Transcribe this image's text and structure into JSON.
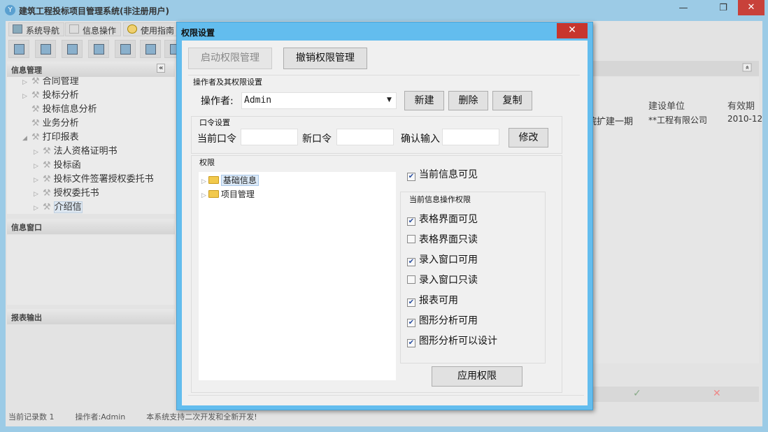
{
  "app": {
    "title": "建筑工程投标项目管理系统(非注册用户)",
    "logo": "Y"
  },
  "window_controls": {
    "minimize": "—",
    "restore": "❐",
    "close": "✕"
  },
  "tabs": [
    {
      "label": "系统导航"
    },
    {
      "label": "信息操作"
    },
    {
      "label": "使用指南"
    }
  ],
  "panels": {
    "info_mgmt": "信息管理",
    "collapse": "«",
    "info_window": "信息窗口",
    "report_output": "报表输出"
  },
  "nav_tree": [
    {
      "label": "合同管理",
      "level": 0,
      "arrow": "▷"
    },
    {
      "label": "投标分析",
      "level": 0,
      "arrow": "▷"
    },
    {
      "label": "投标信息分析",
      "level": 0,
      "arrow": ""
    },
    {
      "label": "业务分析",
      "level": 0,
      "arrow": ""
    },
    {
      "label": "打印报表",
      "level": 0,
      "arrow": "◢"
    },
    {
      "label": "法人资格证明书",
      "level": 1,
      "arrow": "▷"
    },
    {
      "label": "投标函",
      "level": 1,
      "arrow": "▷"
    },
    {
      "label": "投标文件签署授权委托书",
      "level": 1,
      "arrow": "▷"
    },
    {
      "label": "授权委托书",
      "level": 1,
      "arrow": "▷"
    },
    {
      "label": "介绍信",
      "level": 1,
      "arrow": "▷",
      "selected": true
    }
  ],
  "grid": {
    "expand": "«",
    "columns": [
      "建设单位",
      "有效期"
    ],
    "row": [
      "院扩建一期",
      "**工程有限公司",
      "2010-12"
    ],
    "ok": "✓",
    "cancel": "✕"
  },
  "status": {
    "records": "当前记录数 1",
    "operator": "操作者:Admin",
    "note": "本系统支持二次开发和全新开发!"
  },
  "dialog": {
    "title": "权限设置",
    "close": "✕",
    "start_btn": "启动权限管理",
    "revoke_btn": "撤销权限管理",
    "operator_section": "操作者及其权限设置",
    "operator_label": "操作者:",
    "operator_value": "Admin",
    "new_btn": "新建",
    "delete_btn": "删除",
    "copy_btn": "复制",
    "pwd_section": "口令设置",
    "cur_pwd": "当前口令",
    "new_pwd": "新口令",
    "confirm_pwd": "确认输入",
    "modify_btn": "修改",
    "perm_section": "权限",
    "perm_tree": [
      {
        "label": "基础信息",
        "selected": true
      },
      {
        "label": "项目管理"
      }
    ],
    "visible": {
      "label": "当前信息可见",
      "checked": true
    },
    "ops_section": "当前信息操作权限",
    "ops": [
      {
        "label": "表格界面可见",
        "checked": true
      },
      {
        "label": "表格界面只读",
        "checked": false
      },
      {
        "label": "录入窗口可用",
        "checked": true
      },
      {
        "label": "录入窗口只读",
        "checked": false
      },
      {
        "label": "报表可用",
        "checked": true
      },
      {
        "label": "图形分析可用",
        "checked": true
      },
      {
        "label": "图形分析可以设计",
        "checked": true
      }
    ],
    "apply_btn": "应用权限"
  }
}
